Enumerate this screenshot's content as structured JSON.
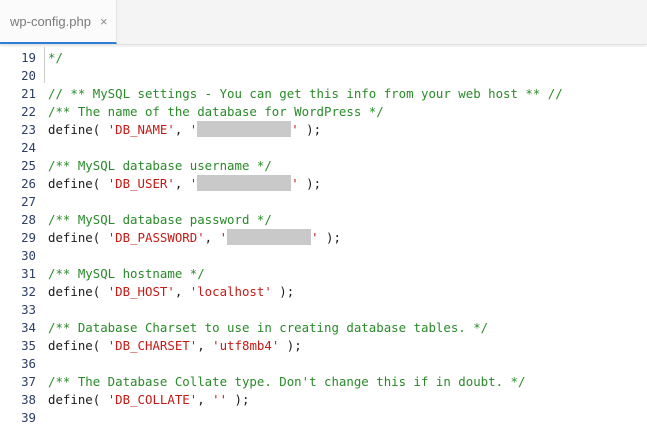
{
  "tab": {
    "label": "wp-config.php",
    "close_glyph": "×"
  },
  "editor": {
    "lines": [
      {
        "n": "19",
        "comment": "*/"
      },
      {
        "n": "20"
      },
      {
        "n": "21",
        "comment": "// ** MySQL settings - You can get this info from your web host ** //"
      },
      {
        "n": "22",
        "comment": "/** The name of the database for WordPress */"
      },
      {
        "n": "23",
        "pre": "define( ",
        "key": "'DB_NAME'",
        "mid": ", ",
        "val_start": "'",
        "val_end": "'",
        "redacted": true,
        "post": " );"
      },
      {
        "n": "24"
      },
      {
        "n": "25",
        "comment": "/** MySQL database username */"
      },
      {
        "n": "26",
        "pre": "define( ",
        "key": "'DB_USER'",
        "mid": ", ",
        "val_start": "'",
        "val_end": "'",
        "redacted": true,
        "post": " );"
      },
      {
        "n": "27"
      },
      {
        "n": "28",
        "comment": "/** MySQL database password */"
      },
      {
        "n": "29",
        "pre": "define( ",
        "key": "'DB_PASSWORD'",
        "mid": ", ",
        "val_start": "'",
        "val_end": "'",
        "redacted": true,
        "post": " );"
      },
      {
        "n": "30"
      },
      {
        "n": "31",
        "comment": "/** MySQL hostname */"
      },
      {
        "n": "32",
        "pre": "define( ",
        "key": "'DB_HOST'",
        "mid": ", ",
        "val": "'localhost'",
        "post": " );"
      },
      {
        "n": "33"
      },
      {
        "n": "34",
        "comment": "/** Database Charset to use in creating database tables. */"
      },
      {
        "n": "35",
        "pre": "define( ",
        "key": "'DB_CHARSET'",
        "mid": ", ",
        "val": "'utf8mb4'",
        "post": " );"
      },
      {
        "n": "36"
      },
      {
        "n": "37",
        "comment": "/** The Database Collate type. Don't change this if in doubt. */"
      },
      {
        "n": "38",
        "pre": "define( ",
        "key": "'DB_COLLATE'",
        "mid": ", ",
        "val": "''",
        "post": " );"
      },
      {
        "n": "39"
      }
    ]
  },
  "colors": {
    "comment": "#2a8a2a",
    "string": "#c41a16",
    "line_number": "#2c3e66",
    "tab_accent": "#2f7fd6",
    "redaction": "#c9c9c9"
  }
}
